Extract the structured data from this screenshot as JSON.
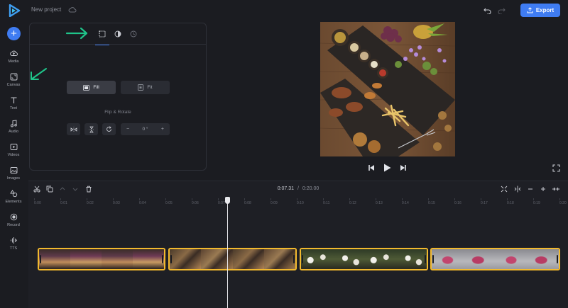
{
  "header": {
    "project_name": "New project",
    "export_label": "Export"
  },
  "sidebar": {
    "items": [
      {
        "label": "Media",
        "icon": "cloud-upload-icon"
      },
      {
        "label": "Canvas",
        "icon": "canvas-icon"
      },
      {
        "label": "Text",
        "icon": "text-icon"
      },
      {
        "label": "Audio",
        "icon": "music-icon"
      },
      {
        "label": "Videos",
        "icon": "video-icon"
      },
      {
        "label": "Images",
        "icon": "image-icon"
      },
      {
        "label": "Elements",
        "icon": "shapes-icon"
      },
      {
        "label": "Record",
        "icon": "record-icon"
      },
      {
        "label": "TTS",
        "icon": "waveform-icon"
      }
    ]
  },
  "panel": {
    "fill_label": "Fill",
    "fit_label": "Fit",
    "flip_rotate_title": "Flip & Rotate",
    "rotation_value": "0 °",
    "minus": "−",
    "plus": "+"
  },
  "timeline": {
    "current_time": "0:07.31",
    "separator": "/",
    "total_time": "0:20.00",
    "ticks": [
      "0:00",
      "0:01",
      "0:02",
      "0:03",
      "0:04",
      "0:05",
      "0:06",
      "0:07",
      "0:08",
      "0:09",
      "0:10",
      "0:11",
      "0:12",
      "0:13",
      "0:14",
      "0:15",
      "0:16",
      "0:17",
      "0:18",
      "0:19",
      "0:20"
    ]
  },
  "colors": {
    "accent": "#3f7cf2",
    "clip_border": "#f2b92e",
    "annotation": "#1fc48a"
  }
}
